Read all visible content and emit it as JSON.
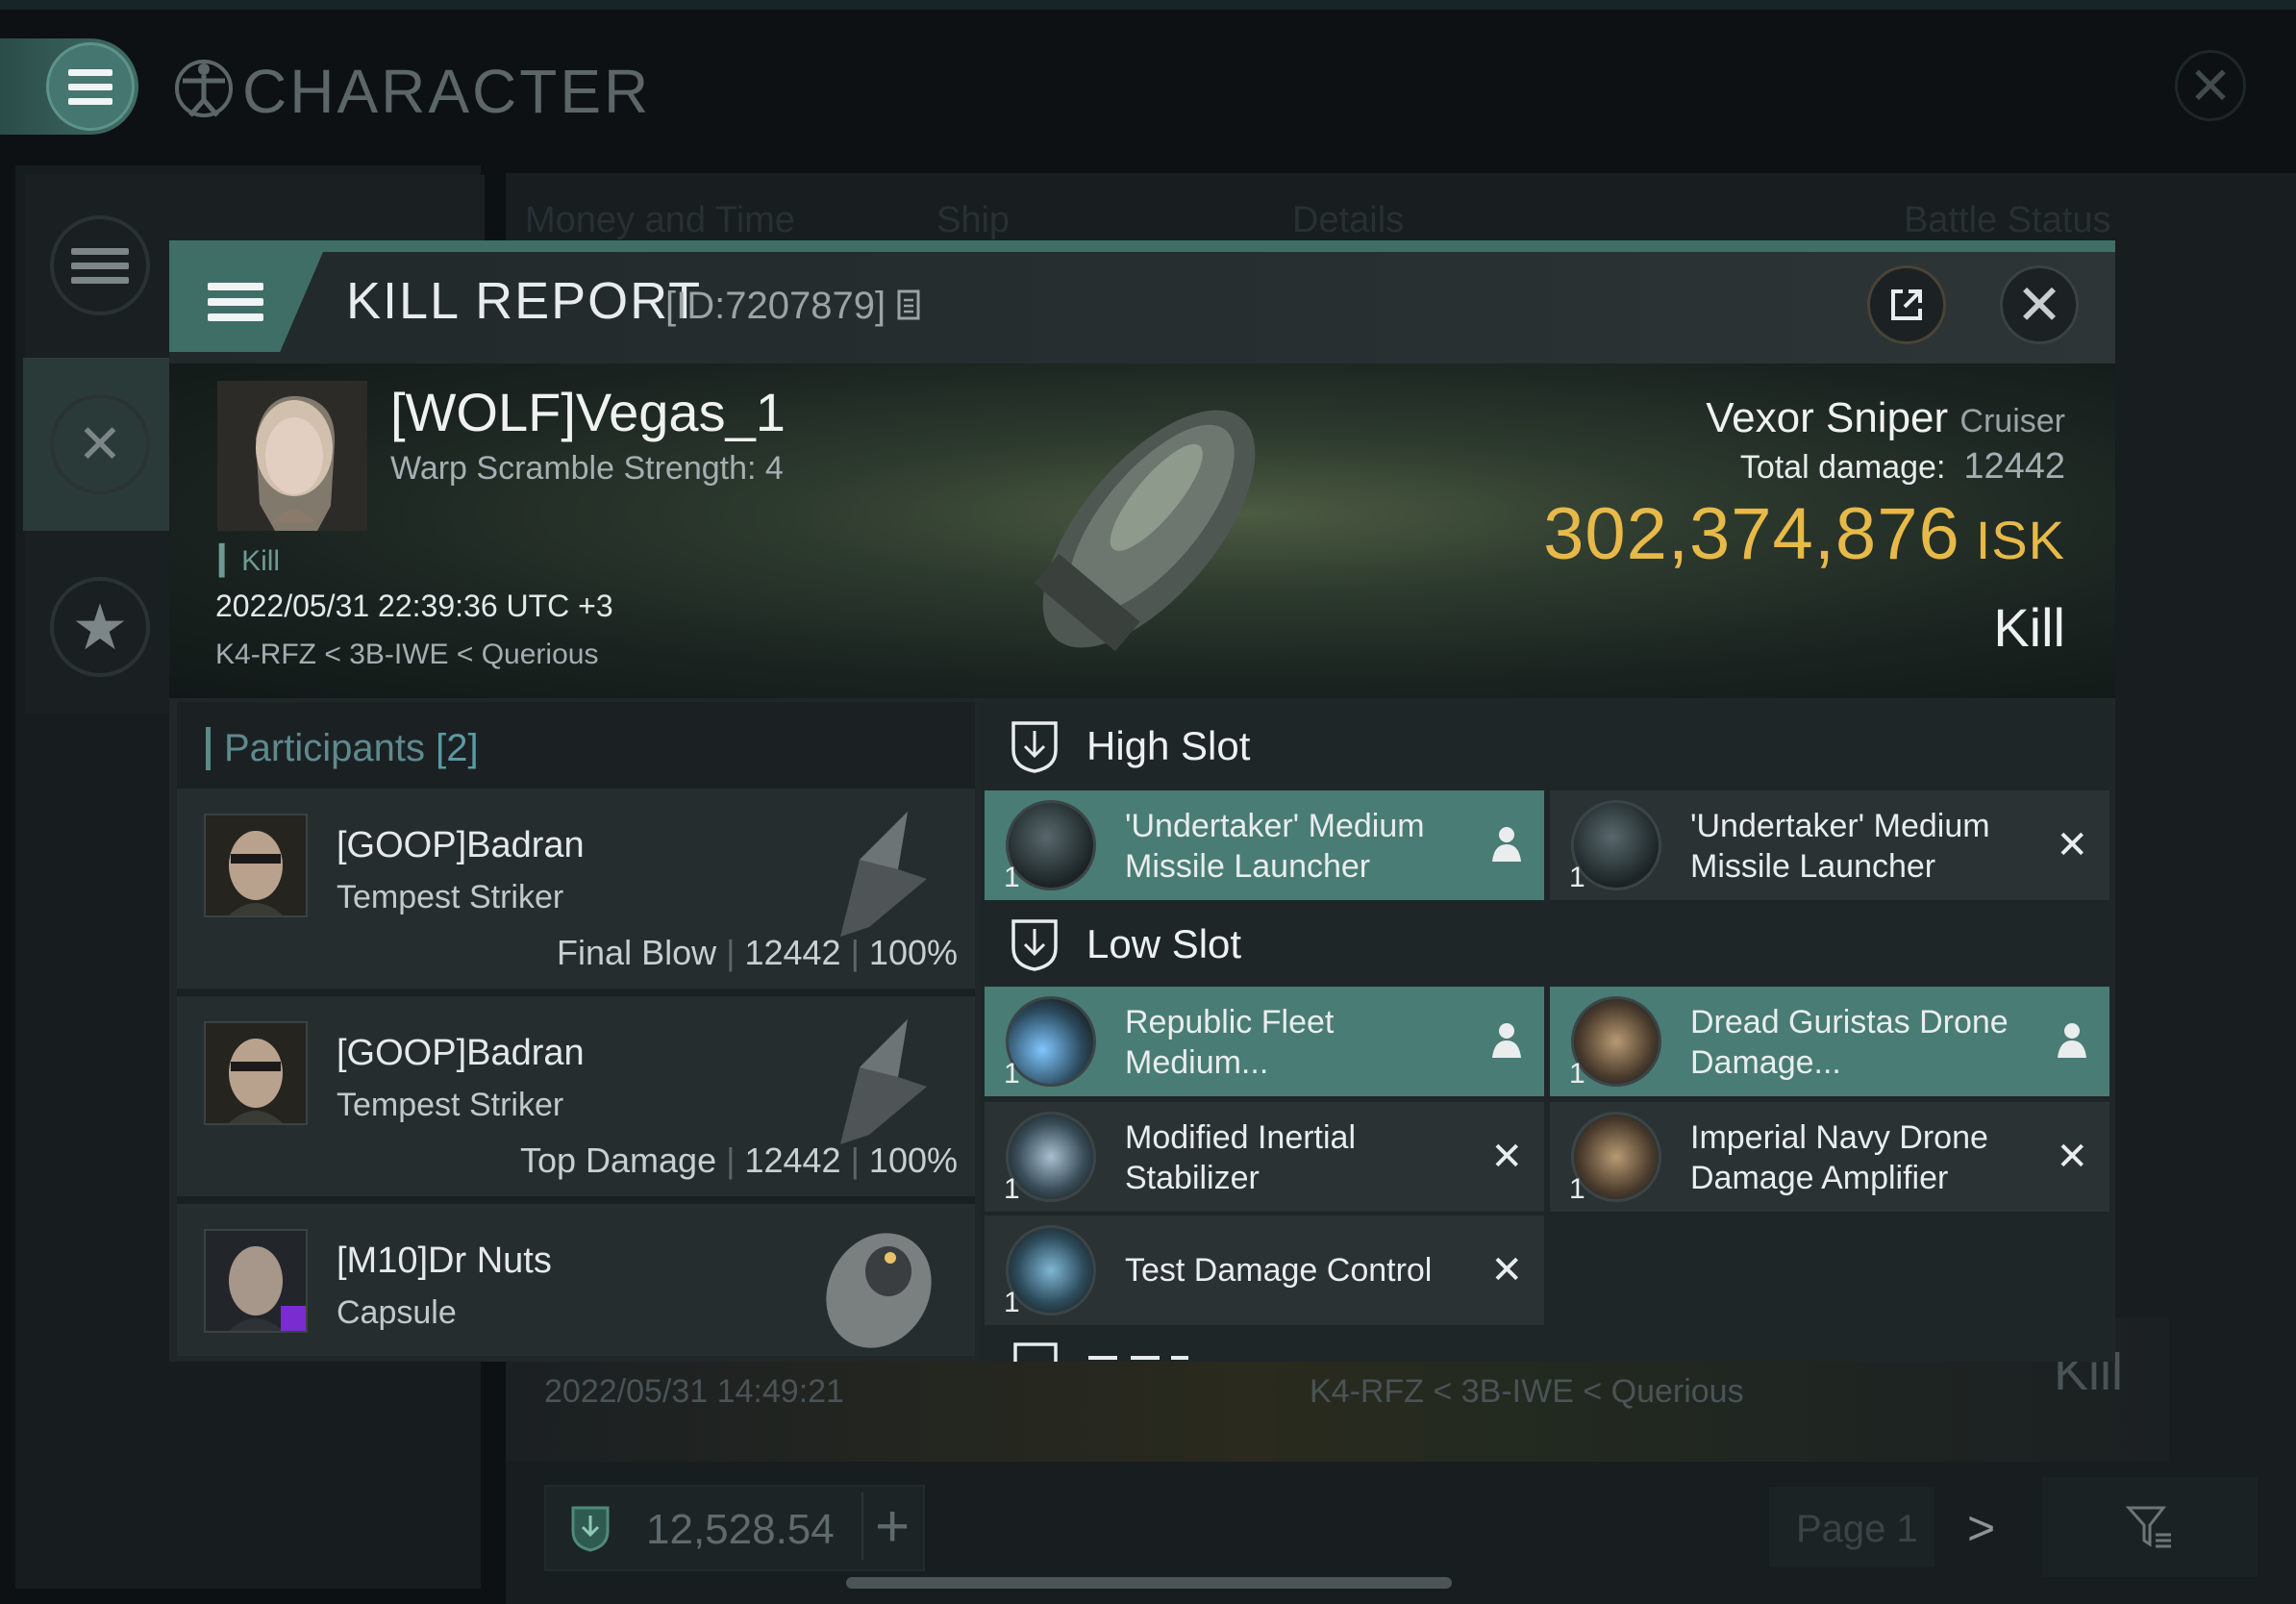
{
  "app": {
    "title": "CHARACTER"
  },
  "background": {
    "columns": [
      "Money and Time",
      "Ship",
      "Details",
      "Battle Status"
    ],
    "row": {
      "date": "2022/05/31  14:49:21",
      "location": "K4-RFZ < 3B-IWE < Querious",
      "result": "Kill"
    },
    "wallet": {
      "value": "12,528.54",
      "add_label": "+"
    },
    "pagination": {
      "page_label": "Page 1",
      "next_label": ">"
    }
  },
  "kill_report": {
    "title": "KILL REPORT",
    "id_label": "[ID:7207879]",
    "victim": {
      "name": "[WOLF]Vegas_1",
      "subtitle": "Warp Scramble Strength: 4",
      "tag": "Kill",
      "datetime": "2022/05/31 22:39:36 UTC +3",
      "location": "K4-RFZ < 3B-IWE < Querious"
    },
    "ship": {
      "name": "Vexor Sniper",
      "class": "Cruiser",
      "total_damage_label": "Total damage:",
      "total_damage": "12442",
      "isk_value": "302,374,876",
      "isk_unit": "ISK",
      "result": "Kill"
    },
    "participants": {
      "label": "Participants",
      "count": "[2]",
      "items": [
        {
          "name": "[GOOP]Badran",
          "ship": "Tempest Striker",
          "role": "Final Blow",
          "damage": "12442",
          "percent": "100%"
        },
        {
          "name": "[GOOP]Badran",
          "ship": "Tempest Striker",
          "role": "Top Damage",
          "damage": "12442",
          "percent": "100%"
        },
        {
          "name": "[M10]Dr Nuts",
          "ship": "Capsule"
        }
      ]
    },
    "fitting": {
      "high_slot_label": "High Slot",
      "low_slot_label": "Low Slot",
      "high": [
        {
          "name": "'Undertaker' Medium Missile Launcher",
          "qty": "1",
          "state": "dropped"
        },
        {
          "name": "'Undertaker' Medium Missile Launcher",
          "qty": "1",
          "state": "destroyed"
        }
      ],
      "low": [
        {
          "name": "Republic Fleet Medium...",
          "qty": "1",
          "state": "dropped"
        },
        {
          "name": "Dread Guristas Drone Damage...",
          "qty": "1",
          "state": "dropped"
        },
        {
          "name": "Modified Inertial Stabilizer",
          "qty": "1",
          "state": "destroyed"
        },
        {
          "name": "Imperial Navy Drone Damage Amplifier",
          "qty": "1",
          "state": "destroyed"
        },
        {
          "name": "Test Damage Control",
          "qty": "1",
          "state": "destroyed"
        }
      ],
      "destroyed_mark": "✕"
    }
  },
  "colors": {
    "accent": "#3f6e67",
    "dropped_bg": "#497c74",
    "isk_gold": "#e7b949",
    "participants_label": "#5e8a8e"
  },
  "icons": [
    "menu-icon",
    "vitruvian-icon",
    "close-icon",
    "crossed-swords-icon",
    "star-icon",
    "copy-icon",
    "export-icon",
    "slot-shield-icon",
    "person-icon",
    "filter-icon",
    "wallet-icon"
  ]
}
